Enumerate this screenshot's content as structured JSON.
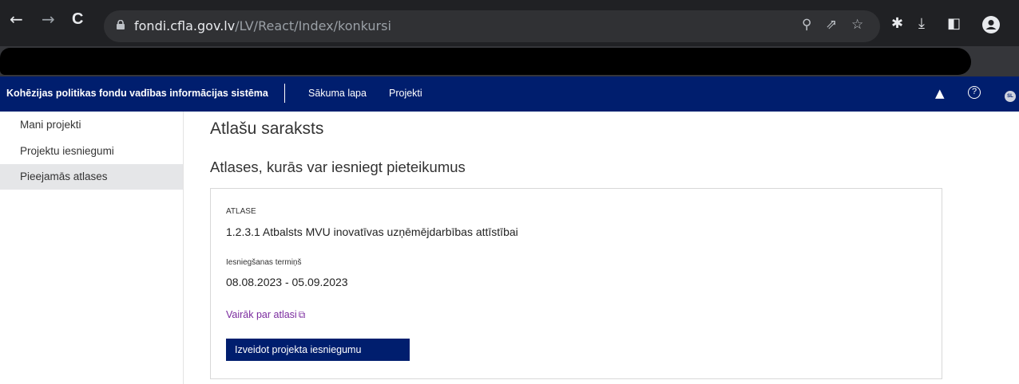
{
  "browser": {
    "back_icon": "←",
    "forward_icon": "→",
    "reload_icon": "C",
    "url_host": "fondi.cfla.gov.lv",
    "url_path": "/LV/React/Index/konkursi",
    "zoom_icon": "⚲",
    "share_icon": "⇗",
    "star_icon": "☆",
    "extensions_icon": "✱",
    "download_icon": "⤓",
    "sidepanel_icon": "◧"
  },
  "header": {
    "app_title": "Kohēzijas politikas fondu vadības informācijas sistēma",
    "nav": [
      {
        "label": "Sākuma lapa"
      },
      {
        "label": "Projekti"
      }
    ],
    "warning_icon": "▲",
    "help_icon": "?",
    "avatar_initials": "SL"
  },
  "sidebar": {
    "items": [
      {
        "label": "Mani projekti",
        "active": false
      },
      {
        "label": "Projektu iesniegumi",
        "active": false
      },
      {
        "label": "Pieejamās atlases",
        "active": true
      }
    ]
  },
  "main": {
    "page_title": "Atlašu saraksts",
    "section_title": "Atlases, kurās var iesniegt pieteikumus",
    "card": {
      "atlase_label": "ATLASE",
      "atlase_value": "1.2.3.1 Atbalsts MVU inovatīvas uzņēmējdarbības attīstībai",
      "deadline_label": "Iesniegšanas termiņš",
      "deadline_value": "08.08.2023 - 05.09.2023",
      "link_label": "Vairāk par atlasi",
      "link_icon": "⧉",
      "button_label": "Izveidot projekta iesniegumu"
    }
  },
  "colors": {
    "header_bg": "#001e6e",
    "link": "#7a2a9e",
    "sidebar_active": "#e5e6e8"
  }
}
